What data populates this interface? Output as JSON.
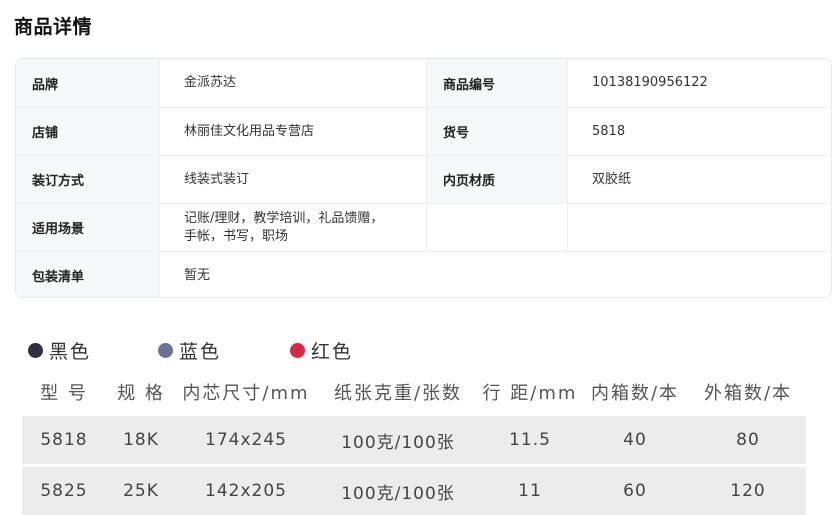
{
  "page_title": "商品详情",
  "specs": {
    "brand_label": "品牌",
    "brand_value": "金派苏达",
    "sku_label": "商品编号",
    "sku_value": "10138190956122",
    "shop_label": "店铺",
    "shop_value": "林丽佳文化用品专营店",
    "item_no_label": "货号",
    "item_no_value": "5818",
    "binding_label": "装订方式",
    "binding_value": "线装式装订",
    "paper_label": "内页材质",
    "paper_value": "双胶纸",
    "scene_label": "适用场景",
    "scene_value_line1": "记账/理财，教学培训，礼品馈赠，",
    "scene_value_line2": "手帐，书写，职场",
    "package_label": "包装清单",
    "package_value": "暂无"
  },
  "colors": [
    {
      "label": "黑色",
      "hex": "#2f2f3f"
    },
    {
      "label": "蓝色",
      "hex": "#6b7390"
    },
    {
      "label": "红色",
      "hex": "#d32b45"
    }
  ],
  "model_table": {
    "headers": [
      "型 号",
      "规 格",
      "内芯尺寸/mm",
      "纸张克重/张数",
      "行 距/mm",
      "内箱数/本",
      "外箱数/本"
    ],
    "rows": [
      [
        "5818",
        "18K",
        "174x245",
        "100克/100张",
        "11.5",
        "40",
        "80"
      ],
      [
        "5825",
        "25K",
        "142x205",
        "100克/100张",
        "11",
        "60",
        "120"
      ]
    ]
  }
}
